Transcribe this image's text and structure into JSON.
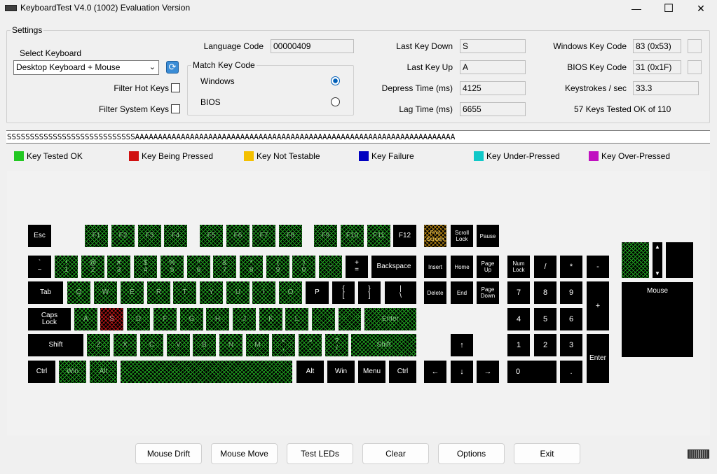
{
  "window": {
    "title": "KeyboardTest V4.0 (1002) Evaluation Version",
    "minimize": "—",
    "maximize": "☐",
    "close": "✕"
  },
  "settings": {
    "title": "Settings",
    "select_keyboard_label": "Select Keyboard",
    "keyboard_value": "Desktop Keyboard + Mouse",
    "filter_hot_keys": "Filter Hot Keys",
    "filter_system_keys": "Filter System Keys",
    "language_code_label": "Language Code",
    "language_code": "00000409",
    "match_key_code": "Match Key Code",
    "windows": "Windows",
    "bios": "BIOS",
    "last_key_down_label": "Last Key Down",
    "last_key_down": "S",
    "last_key_up_label": "Last Key Up",
    "last_key_up": "A",
    "depress_time_label": "Depress Time (ms)",
    "depress_time": "4125",
    "lag_time_label": "Lag Time (ms)",
    "lag_time": "6655",
    "windows_key_code_label": "Windows Key Code",
    "windows_key_code": "83 (0x53)",
    "bios_key_code_label": "BIOS Key Code",
    "bios_key_code": "31 (0x1F)",
    "keystrokes_label": "Keystrokes / sec",
    "keystrokes": "33.3",
    "tested_summary": "57 Keys Tested OK of 110"
  },
  "stream": "SSSSSSSSSSSSSSSSSSSSSSSSSSSSAAAAAAAAAAAAAAAAAAAAAAAAAAAAAAAAAAAAAAAAAAAAAAAAAAAAAAAAAAAAAAAAAAAAAA",
  "legend": [
    {
      "label": "Key Tested OK",
      "color": "#22c822"
    },
    {
      "label": "Key Being Pressed",
      "color": "#d01010"
    },
    {
      "label": "Key Not Testable",
      "color": "#f4c000"
    },
    {
      "label": "Key Failure",
      "color": "#0000c0"
    },
    {
      "label": "Key Under-Pressed",
      "color": "#10c8c8"
    },
    {
      "label": "Key Over-Pressed",
      "color": "#c010c0"
    }
  ],
  "keys": {
    "esc": "Esc",
    "f1": "F1",
    "f2": "F2",
    "f3": "F3",
    "f4": "F4",
    "f5": "F5",
    "f6": "F6",
    "f7": "F7",
    "f8": "F8",
    "f9": "F9",
    "f10": "F10",
    "f11": "F11",
    "f12": "F12",
    "prtsc": "Prnt\nScreen",
    "scroll": "Scroll\nLock",
    "pause": "Pause",
    "tilde": "`\n~",
    "k1": "!\n1",
    "k2": "@\n2",
    "k3": "#\n3",
    "k4": "$\n4",
    "k5": "%\n5",
    "k6": "^\n6",
    "k7": "&\n7",
    "k8": "*\n8",
    "k9": "(\n9",
    "k0": ")\n0",
    "minus": "_\n-",
    "equal": "+\n=",
    "backspace": "Backspace",
    "insert": "Insert",
    "home": "Home",
    "pgup": "Page\nUp",
    "numlock": "Num\nLock",
    "ndiv": "/",
    "nmul": "*",
    "nminus": "-",
    "tab": "Tab",
    "q": "Q",
    "w": "W",
    "e": "E",
    "r": "R",
    "t": "T",
    "y": "Y",
    "u": "U",
    "i": "I",
    "o": "O",
    "p": "P",
    "lbr": "{\n[",
    "rbr": "}\n]",
    "bslash": "|\n\\",
    "delete": "Delete",
    "end": "End",
    "pgdn": "Page\nDown",
    "n7": "7",
    "n8": "8",
    "n9": "9",
    "nplus": "+",
    "caps": "Caps\nLock",
    "a": "A",
    "s": "S",
    "d": "D",
    "f": "F",
    "g": "G",
    "h": "H",
    "j": "J",
    "k": "K",
    "l": "L",
    "semi": "",
    "quote": "",
    "enter": "Enter",
    "n4": "4",
    "n5": "5",
    "n6": "6",
    "lshift": "Shift",
    "z": "Z",
    "x": "X",
    "c": "C",
    "v": "V",
    "b": "B",
    "n": "N",
    "m": "M",
    "comma": "<\n,",
    "period": ">\n.",
    "slash": "?\n/",
    "rshift": "Shift",
    "up": "↑",
    "n1": "1",
    "n2": "2",
    "n3": "3",
    "nenter": "Enter",
    "lctrl": "Ctrl",
    "lwin": "Win",
    "lalt": "Alt",
    "space": "",
    "ralt": "Alt",
    "rwin": "Win",
    "menu": "Menu",
    "rctrl": "Ctrl",
    "left": "←",
    "down": "↓",
    "right": "→",
    "n0": "0",
    "ndot": ".",
    "mouse": "Mouse"
  },
  "buttons": {
    "mouse_drift": "Mouse Drift",
    "mouse_move": "Mouse Move",
    "test_leds": "Test LEDs",
    "clear": "Clear",
    "options": "Options",
    "exit": "Exit"
  }
}
